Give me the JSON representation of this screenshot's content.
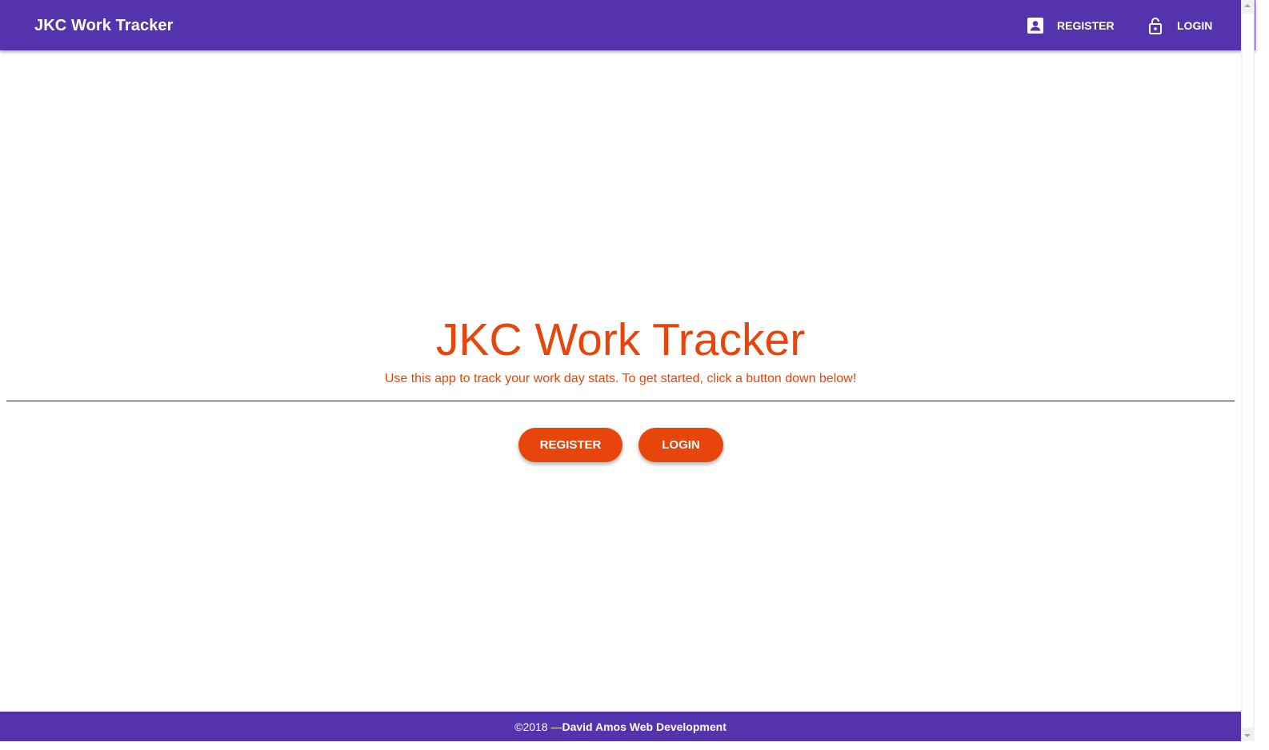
{
  "app": {
    "title": "JKC Work Tracker"
  },
  "toolbar": {
    "brand": "JKC Work Tracker",
    "register_label": "REGISTER",
    "register_icon": "account-box-icon",
    "login_label": "LOGIN",
    "login_icon": "lock-open-icon"
  },
  "hero": {
    "title": "JKC Work Tracker",
    "subtitle": "Use this app to track your work day stats. To get started, click a button down below!"
  },
  "actions": {
    "register_label": "REGISTER",
    "login_label": "LOGIN"
  },
  "footer": {
    "prefix": "©2018 —",
    "owner": "David Amos Web Development"
  },
  "colors": {
    "primary": "#5533ac",
    "accent": "#e7450c",
    "background": "#ffffff"
  }
}
